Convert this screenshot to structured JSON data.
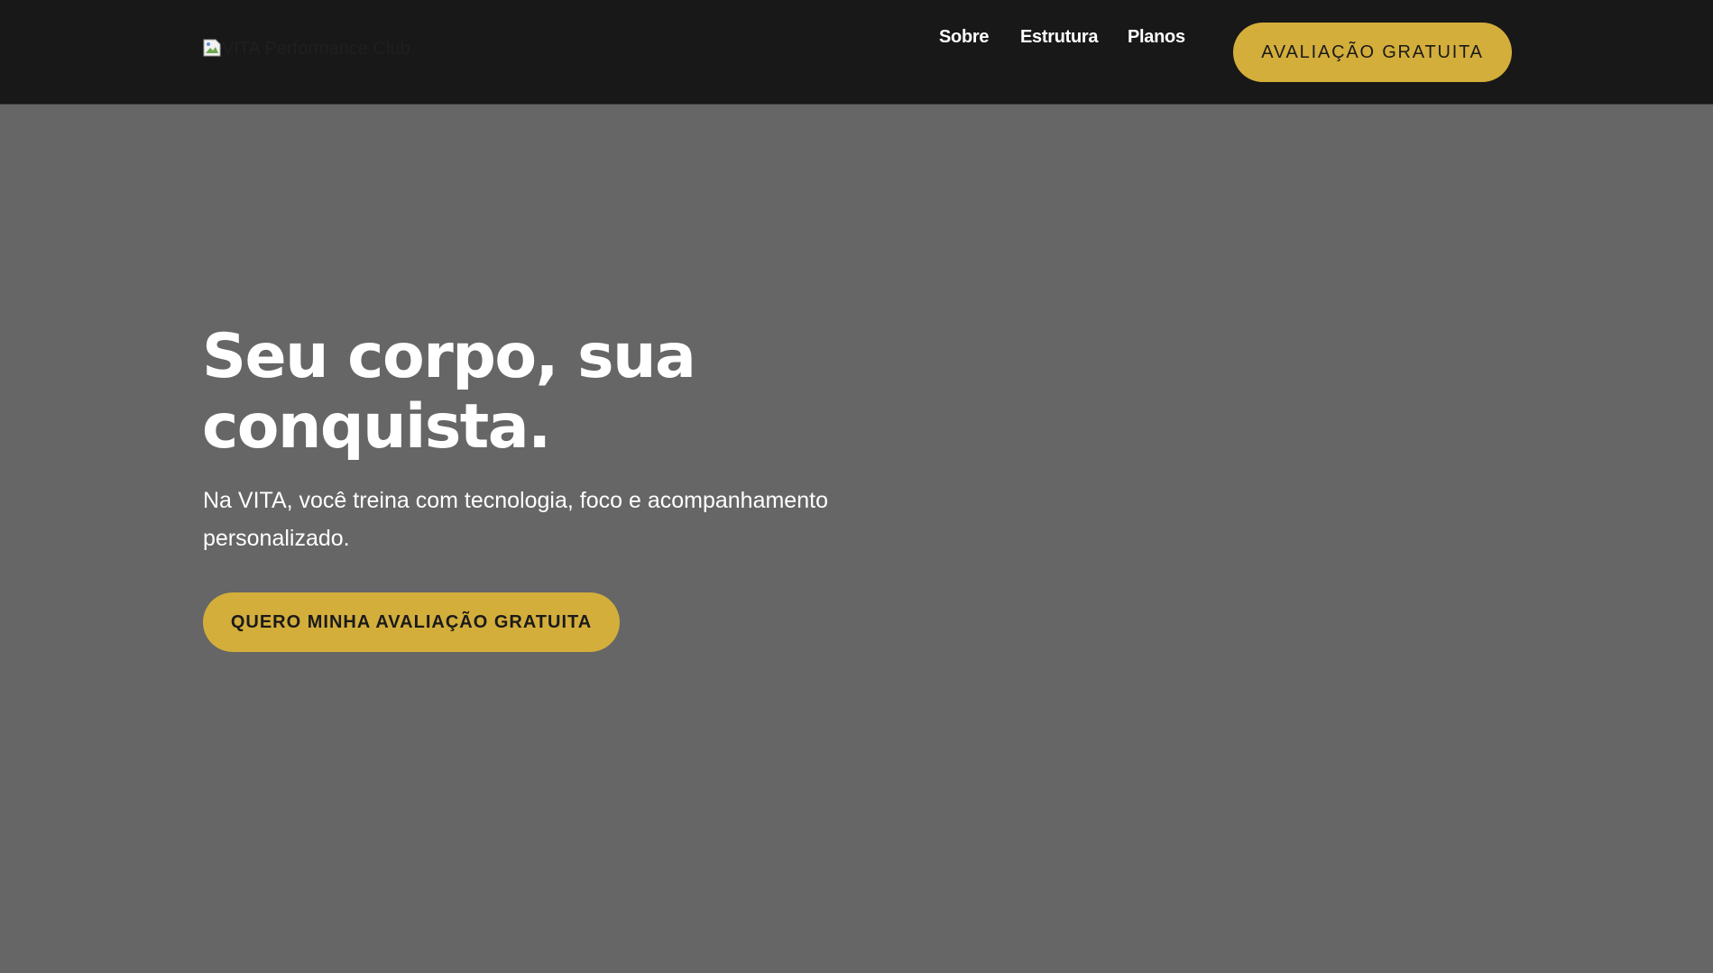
{
  "header": {
    "logo_alt": "VITA Performance Club",
    "nav": {
      "sobre": "Sobre",
      "estrutura": "Estrutura",
      "planos": "Planos"
    },
    "cta_label": "AVALIAÇÃO GRATUITA"
  },
  "hero": {
    "title_line1": "Seu corpo, sua",
    "title_line2": "conquista.",
    "subtitle_line1": "Na VITA, você treina com tecnologia, foco e acompanhamento",
    "subtitle_line2": "personalizado.",
    "cta_label": "QUERO MINHA AVALIAÇÃO GRATUITA"
  },
  "icons": {
    "logo": "broken-image-icon"
  },
  "colors": {
    "header_bg": "#181818",
    "hero_bg": "#666666",
    "accent": "#d4ae3b",
    "text_light": "#ffffff",
    "text_dark": "#1a1a1a"
  }
}
